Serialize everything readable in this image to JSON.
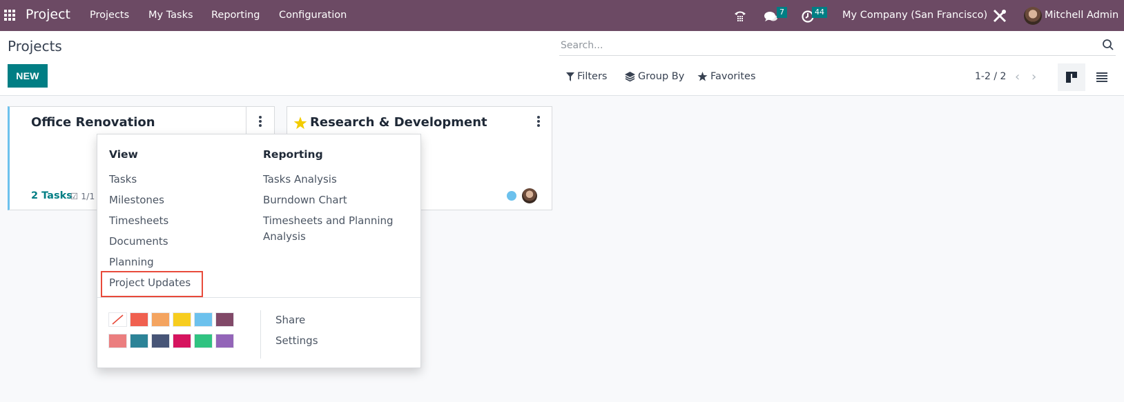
{
  "navbar": {
    "app_name": "Project",
    "menu": [
      "Projects",
      "My Tasks",
      "Reporting",
      "Configuration"
    ],
    "messages_badge": "7",
    "activities_badge": "44",
    "company": "My Company (San Francisco)",
    "user": "Mitchell Admin",
    "icons": [
      "apps-grid-icon",
      "phone-icon",
      "chat-icon",
      "clock-icon",
      "debug-tools-icon",
      "user-avatar"
    ]
  },
  "control_panel": {
    "title": "Projects",
    "new_label": "NEW",
    "search_placeholder": "Search...",
    "filters_label": "Filters",
    "group_by_label": "Group By",
    "favorites_label": "Favorites",
    "pager": "1-2 / 2",
    "active_view": "kanban"
  },
  "cards": [
    {
      "title": "Office Renovation",
      "favorite": false,
      "tasks_label": "2 Tasks",
      "milestones": "1/1",
      "color": "#6cc1ed"
    },
    {
      "title": "Research & Development",
      "favorite": true,
      "status_color": "#6cc1ed"
    }
  ],
  "dropdown": {
    "view_heading": "View",
    "view_items": [
      "Tasks",
      "Milestones",
      "Timesheets",
      "Documents",
      "Planning",
      "Project Updates"
    ],
    "highlighted_item": "Project Updates",
    "reporting_heading": "Reporting",
    "reporting_items": [
      "Tasks Analysis",
      "Burndown Chart",
      "Timesheets and Planning Analysis"
    ],
    "colors": [
      "none",
      "#f06050",
      "#f4a460",
      "#f7cd1f",
      "#6cc1ed",
      "#814968",
      "#eb7e7f",
      "#2c8397",
      "#475577",
      "#d6145f",
      "#30c381",
      "#9365b8"
    ],
    "actions": [
      "Share",
      "Settings"
    ]
  }
}
